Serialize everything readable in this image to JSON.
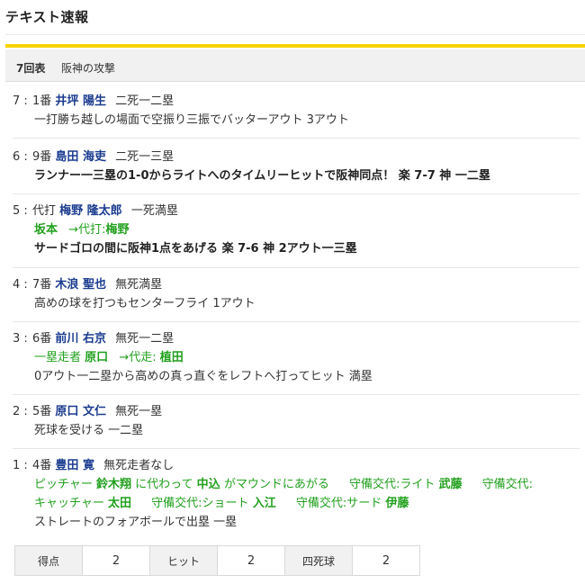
{
  "header": {
    "title": "テキスト速報"
  },
  "inning": {
    "number": "7回表",
    "description": "阪神の攻撃"
  },
  "plays": [
    {
      "num": "7",
      "order": "1番",
      "player": "井坪 陽生",
      "situation": "二死一二塁",
      "result": "一打勝ち越しの場面で空振り三振でバッターアウト 3アウト"
    },
    {
      "num": "6",
      "order": "9番",
      "player": "島田 海吏",
      "situation": "二死一三塁",
      "result": "ランナー一三塁の1-0からライトへのタイムリーヒットで阪神同点！ 楽 7-7 神 一二塁"
    },
    {
      "num": "5",
      "order": "代打",
      "player": "梅野 隆太郎",
      "situation": "一死満塁",
      "sub": {
        "from": "坂本",
        "arrow": "→代打:",
        "to": "梅野"
      },
      "result": "サードゴロの間に阪神1点をあげる 楽 7-6 神 2アウト一三塁"
    },
    {
      "num": "4",
      "order": "7番",
      "player": "木浪 聖也",
      "situation": "無死満塁",
      "result": "高めの球を打つもセンターフライ 1アウト"
    },
    {
      "num": "3",
      "order": "6番",
      "player": "前川 右京",
      "situation": "無死一二塁",
      "sub": {
        "prefix": "一塁走者",
        "from": "原口",
        "arrow": "→代走:",
        "to": "植田"
      },
      "result": "0アウト一二塁から高めの真っ直ぐをレフトへ打ってヒット 満塁"
    },
    {
      "num": "2",
      "order": "5番",
      "player": "原口 文仁",
      "situation": "無死一塁",
      "result": "死球を受ける 一二塁"
    },
    {
      "num": "1",
      "order": "4番",
      "player": "豊田 寛",
      "situation": "無死走者なし",
      "changes1": {
        "p1": "ピッチャー",
        "b1": "鈴木翔",
        "p2": "に代わって",
        "b2": "中込",
        "p3": "がマウンドにあがる",
        "p4": "守備交代:ライト",
        "b3": "武藤",
        "p5": "守備交代:"
      },
      "changes2": {
        "p1": "キャッチャー",
        "b1": "太田",
        "p2": "守備交代:ショート",
        "b2": "入江",
        "p3": "守備交代:サード",
        "b3": "伊藤"
      },
      "result": "ストレートのフォアボールで出塁 一塁"
    }
  ],
  "stats": [
    {
      "label": "得点",
      "value": "2"
    },
    {
      "label": "ヒット",
      "value": "2"
    },
    {
      "label": "四死球",
      "value": "2"
    }
  ]
}
